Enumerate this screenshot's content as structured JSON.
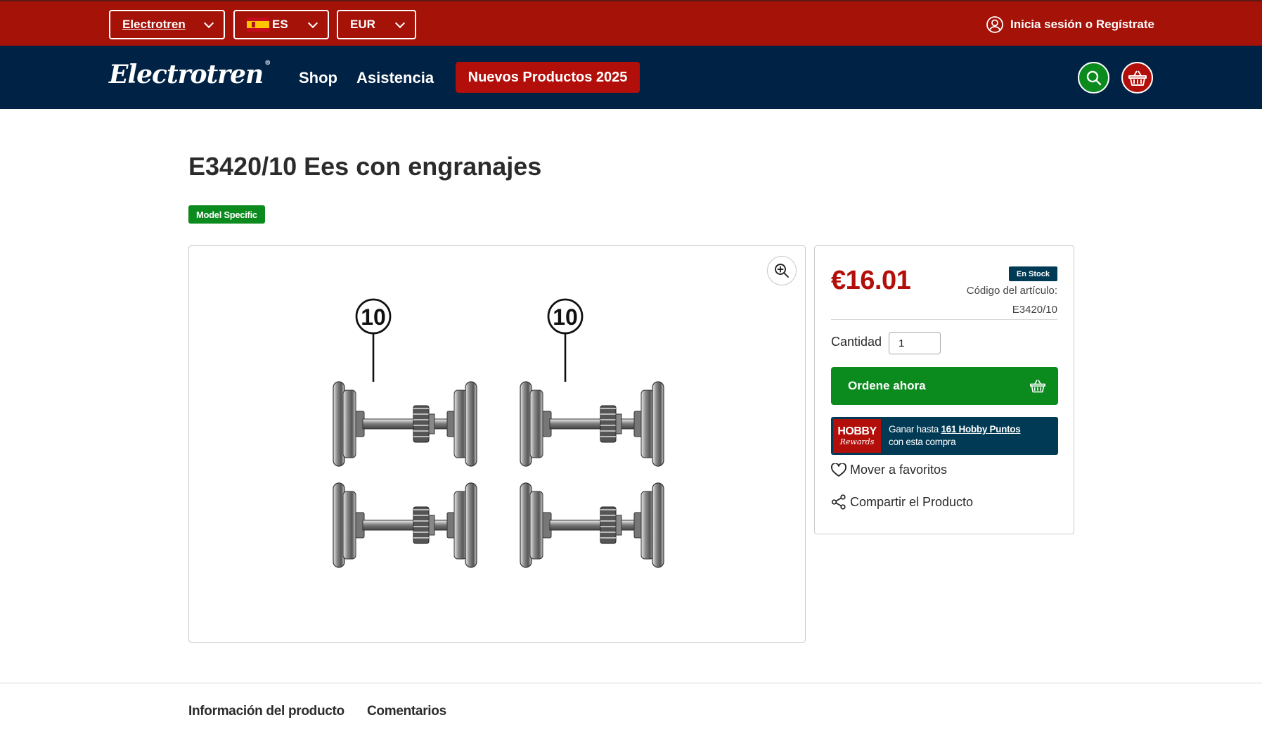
{
  "topbar": {
    "brand_select": "Electrotren",
    "language_select": "ES",
    "currency_select": "EUR",
    "login_label": "Inicia sesión o Regístrate"
  },
  "nav": {
    "logo": "Electrotren",
    "logo_mark": "®",
    "links": [
      {
        "label": "Shop"
      },
      {
        "label": "Asistencia"
      }
    ],
    "promo_button": "Nuevos Productos 2025"
  },
  "product": {
    "title": "E3420/10 Ees con engranajes",
    "badge": "Model Specific",
    "image_callouts": [
      "10",
      "10"
    ]
  },
  "buybox": {
    "price": "€16.01",
    "stock_badge": "En Stock",
    "code_label": "Código del artículo:",
    "code_value": "E3420/10",
    "quantity_label": "Cantidad",
    "quantity_value": "1",
    "order_button": "Ordene ahora",
    "hobby": {
      "logo_top": "HOBBY",
      "logo_bottom": "Rewards",
      "text_before": "Ganar hasta",
      "points_link": "161 Hobby Puntos",
      "text_after": "con esta compra"
    },
    "favorites_label": "Mover a favoritos",
    "share_label": "Compartir el Producto"
  },
  "tabs": [
    {
      "label": "Información del producto"
    },
    {
      "label": "Comentarios"
    }
  ],
  "colors": {
    "topbar_red": "#a51208",
    "nav_navy": "#002244",
    "accent_green": "#0b8a1e",
    "price_red": "#b30f0a",
    "hobby_navy": "#003a55"
  }
}
